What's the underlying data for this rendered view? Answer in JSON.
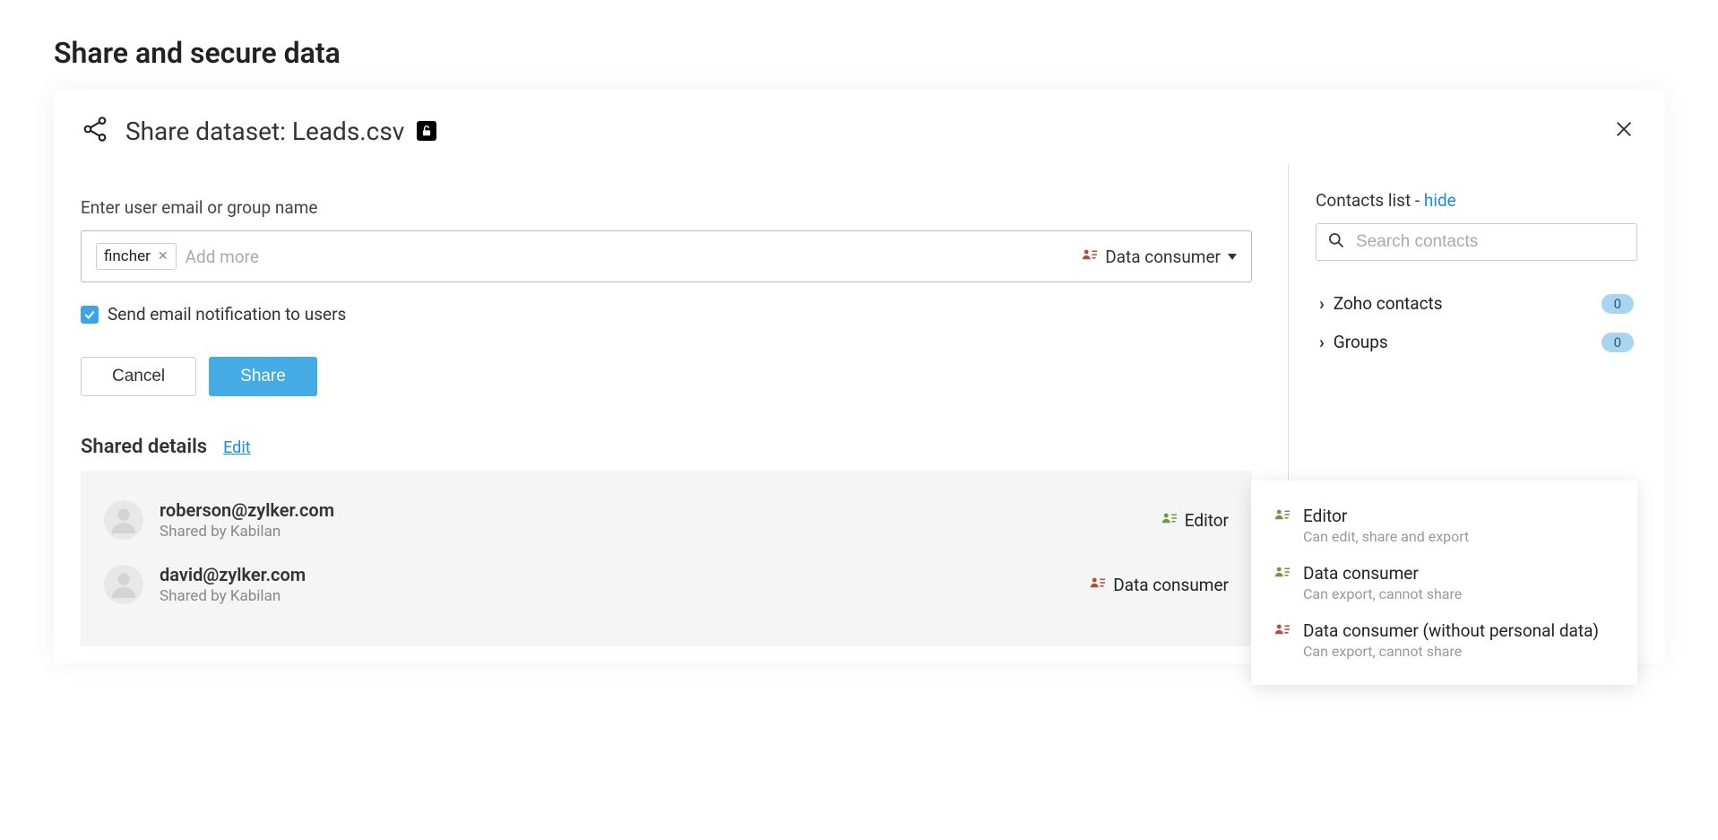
{
  "page": {
    "title": "Share and secure data"
  },
  "modal": {
    "title": "Share dataset: Leads.csv"
  },
  "form": {
    "label": "Enter user email or group name",
    "chip": "fincher",
    "add_more": "Add more",
    "role_selected": "Data consumer",
    "notify_label": "Send email notification to users",
    "cancel_label": "Cancel",
    "share_label": "Share"
  },
  "shared": {
    "header": "Shared details",
    "edit": "Edit",
    "items": [
      {
        "email": "roberson@zylker.com",
        "by": "Shared by Kabilan",
        "role": "Editor",
        "role_kind": "editor"
      },
      {
        "email": "david@zylker.com",
        "by": "Shared by Kabilan",
        "role": "Data consumer",
        "role_kind": "consumer"
      }
    ]
  },
  "contacts": {
    "header_prefix": "Contacts list - ",
    "hide": "hide",
    "search_placeholder": "Search contacts",
    "groups": [
      {
        "label": "Zoho contacts",
        "count": "0"
      },
      {
        "label": "Groups",
        "count": "0"
      }
    ]
  },
  "role_menu": [
    {
      "name": "Editor",
      "desc": "Can edit, share and export",
      "kind": "editor"
    },
    {
      "name": "Data consumer",
      "desc": "Can export, cannot share",
      "kind": "consumer"
    },
    {
      "name": "Data consumer (without personal data)",
      "desc": "Can export, cannot share",
      "kind": "nopersonal"
    }
  ]
}
